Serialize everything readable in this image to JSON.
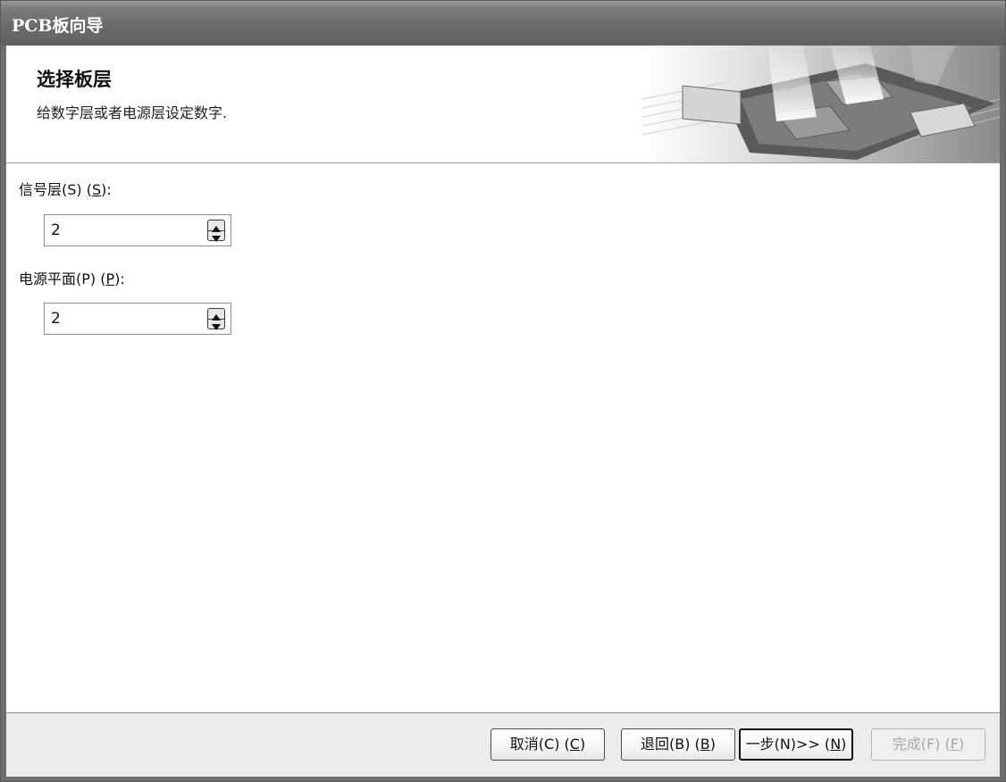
{
  "window": {
    "title": "PCB板向导"
  },
  "header": {
    "heading": "选择板层",
    "subheading": "给数字层或者电源层设定数字."
  },
  "fields": {
    "signal_layers": {
      "label": "信号层(S) (",
      "mnemonic": "S",
      "label_suffix": "):",
      "value": "2"
    },
    "power_planes": {
      "label": "电源平面(P) (",
      "mnemonic": "P",
      "label_suffix": "):",
      "value": "2"
    }
  },
  "buttons": {
    "cancel": {
      "label": "取消(C) (",
      "mnemonic": "C",
      "suffix": ")"
    },
    "back": {
      "label": "退回(B) (",
      "mnemonic": "B",
      "suffix": ")"
    },
    "next": {
      "label": "一步(N)>> (",
      "mnemonic": "N",
      "suffix": ")"
    },
    "finish": {
      "label": "完成(F) (",
      "mnemonic": "F",
      "suffix": ")"
    }
  },
  "icons": {
    "spin_up": "triangle-up-icon",
    "spin_down": "triangle-down-icon",
    "banner": "pcb-chip-graphic"
  },
  "colors": {
    "titlebar": "#6a6a6a",
    "footer": "#ececec",
    "disabled_text": "#a8a8a8"
  }
}
